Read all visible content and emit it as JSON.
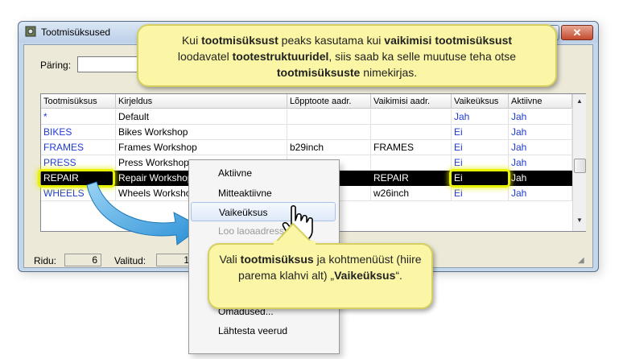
{
  "window": {
    "title": "Tootmisüksused",
    "close_glyph": "✕"
  },
  "query": {
    "label": "Päring:",
    "value": ""
  },
  "grid": {
    "columns": [
      "Tootmisüksus",
      "Kirjeldus",
      "Lõpptoote aadr.",
      "Vaikimisi aadr.",
      "Vaikeüksus",
      "Aktiivne"
    ],
    "rows": [
      {
        "unit": "*",
        "desc": "Default",
        "final": "",
        "default_addr": "",
        "is_default": "Jah",
        "active": "Jah"
      },
      {
        "unit": "BIKES",
        "desc": "Bikes Workshop",
        "final": "",
        "default_addr": "",
        "is_default": "Ei",
        "active": "Jah"
      },
      {
        "unit": "FRAMES",
        "desc": "Frames Workshop",
        "final": "b29inch",
        "default_addr": "FRAMES",
        "is_default": "Ei",
        "active": "Jah"
      },
      {
        "unit": "PRESS",
        "desc": "Press Workshop",
        "final": "",
        "default_addr": "",
        "is_default": "Ei",
        "active": "Jah"
      },
      {
        "unit": "REPAIR",
        "desc": "Repair Workshop",
        "final": "",
        "default_addr": "REPAIR",
        "is_default": "Ei",
        "active": "Jah"
      },
      {
        "unit": "WHEELS",
        "desc": "Wheels Workshop",
        "final": "",
        "default_addr": "w26inch",
        "is_default": "Ei",
        "active": "Jah"
      }
    ]
  },
  "status": {
    "rows_label": "Ridu:",
    "rows_value": "6",
    "selected_label": "Valitud:",
    "selected_value": "1"
  },
  "context_menu": {
    "items": [
      "Aktiivne",
      "Mitteaktiivne",
      "Vaikeüksus",
      "Loo laoaadress",
      "Omadused...",
      "Lähtesta veerud"
    ]
  },
  "callout_top": {
    "p1": "Kui ",
    "b1": "tootmisüksust",
    "p2": " peaks kasutama kui ",
    "b2": "vaikimisi tootmisüksust",
    "p3": " loodavatel ",
    "b3": "tootestruktuuridel",
    "p4": ", siis saab ka selle muutuse teha otse ",
    "b4": "tootmisüksuste",
    "p5": " nimekirjas."
  },
  "callout_bottom": {
    "p1": "Vali ",
    "b1": "tootmisüksus",
    "p2": " ja kohtmenüüst (hiire parema klahvi alt) „",
    "b2": "Vaikeüksus",
    "p3": "“."
  },
  "colors": {
    "highlight": "#e8f200",
    "callout_bg": "#faf6a5",
    "link_blue": "#1f3ad3",
    "arrow": "#3aa0e0"
  }
}
